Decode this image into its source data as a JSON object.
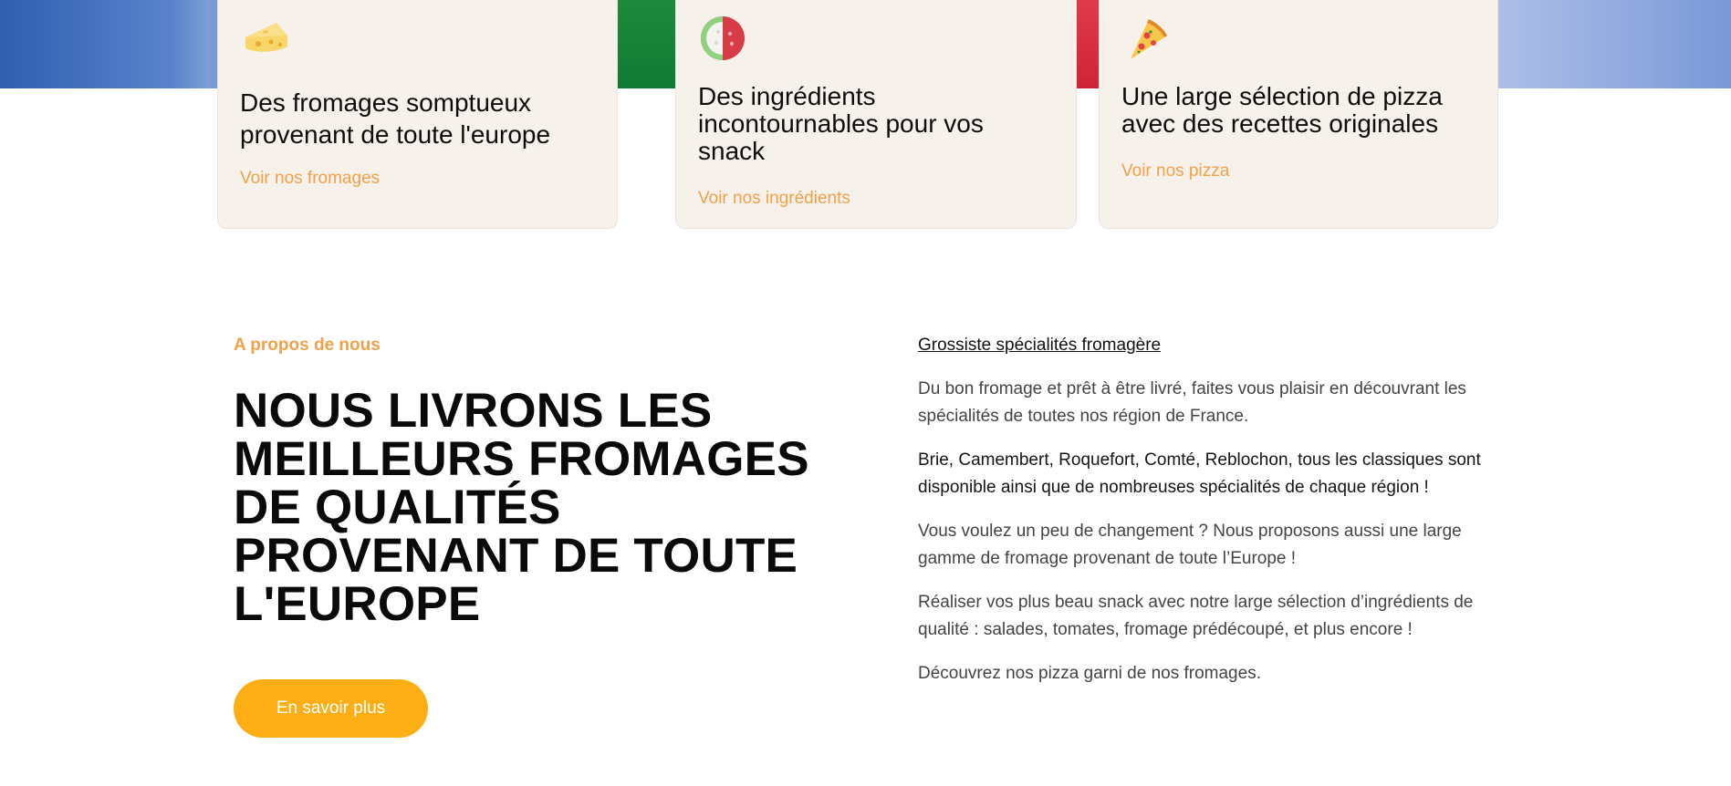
{
  "colors": {
    "accent_orange": "#f0a24a",
    "cta_yellow": "#fdae14",
    "card_background": "#f6f1eb"
  },
  "cards": [
    {
      "icon": "cheese-icon",
      "title": "Des fromages somptueux provenant de toute l'europe",
      "link": "Voir nos fromages"
    },
    {
      "icon": "tomato-mozzarella-icon",
      "title": "Des ingrédients incontournables pour vos snack",
      "link": "Voir nos ingrédients"
    },
    {
      "icon": "pizza-slice-icon",
      "title": "Une large sélection de pizza avec des recettes originales",
      "link": "Voir nos pizza"
    }
  ],
  "about": {
    "eyebrow": "A propos de nous",
    "title": "NOUS LIVRONS LES MEILLEURS FROMAGES DE QUALITÉS PROVENANT DE TOUTE L'EUROPE",
    "cta_label": "En savoir plus",
    "sub_heading": "Grossiste spécialités fromagère",
    "paragraphs": [
      "Du bon fromage  et prêt à être livré, faites vous plaisir en découvrant les spécialités de toutes nos région de France.",
      "Brie, Camembert, Roquefort, Comté, Reblochon, tous les classiques sont disponible ainsi que de nombreuses spécialités de chaque région !",
      "Vous voulez un peu de changement ? Nous proposons aussi une large gamme de fromage provenant de toute l’Europe !",
      "Réaliser vos plus beau snack avec notre large sélection d’ingrédients de qualité : salades, tomates, fromage prédécoupé, et plus encore !",
      "Découvrez nos pizza garni de nos fromages."
    ]
  }
}
